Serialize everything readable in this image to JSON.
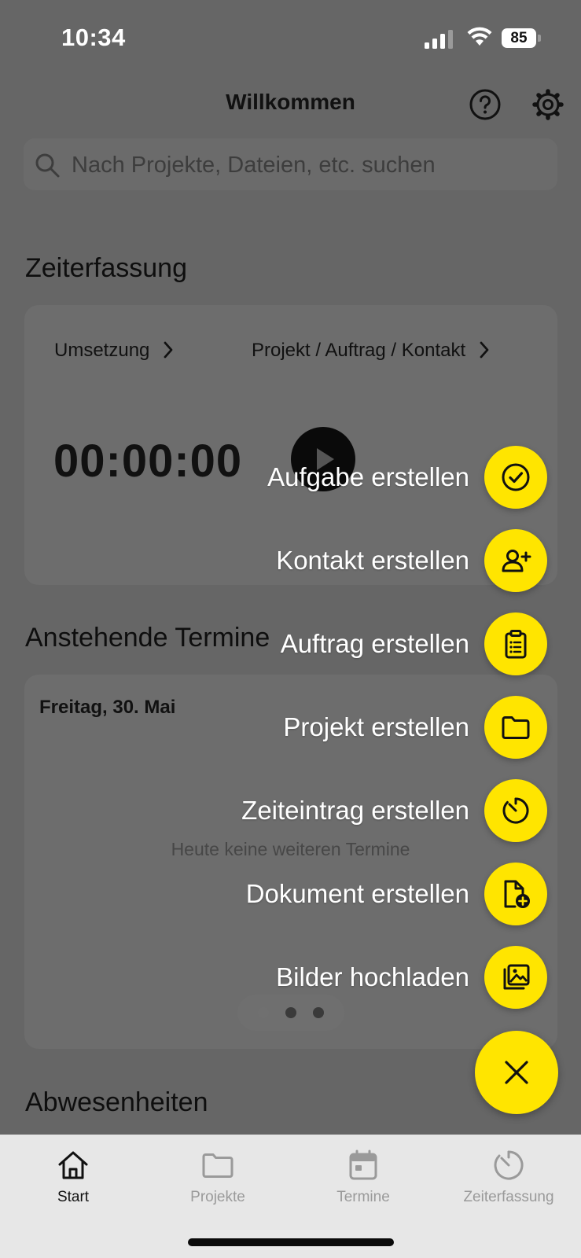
{
  "status_bar": {
    "time": "10:34",
    "battery": "85"
  },
  "header": {
    "title": "Willkommen"
  },
  "search": {
    "placeholder": "Nach Projekte, Dateien, etc. suchen"
  },
  "time_tracking": {
    "title": "Zeiterfassung",
    "activity": "Umsetzung",
    "target": "Projekt / Auftrag / Kontakt",
    "timer": "00:00:00"
  },
  "appointments": {
    "title": "Anstehende Termine",
    "date": "Freitag, 30. Mai",
    "empty": "Heute keine weiteren Termine"
  },
  "absences": {
    "title": "Abwesenheiten"
  },
  "fab_menu": {
    "items": [
      {
        "label": "Aufgabe erstellen",
        "icon": "check-circle-icon"
      },
      {
        "label": "Kontakt erstellen",
        "icon": "user-plus-icon"
      },
      {
        "label": "Auftrag erstellen",
        "icon": "clipboard-list-icon"
      },
      {
        "label": "Projekt erstellen",
        "icon": "folder-icon"
      },
      {
        "label": "Zeiteintrag erstellen",
        "icon": "timer-icon"
      },
      {
        "label": "Dokument erstellen",
        "icon": "document-plus-icon"
      },
      {
        "label": "Bilder hochladen",
        "icon": "images-icon"
      }
    ],
    "close_icon": "close-icon",
    "accent": "#FFE500"
  },
  "tabbar": {
    "tabs": [
      {
        "label": "Start",
        "icon": "home-icon",
        "active": true
      },
      {
        "label": "Projekte",
        "icon": "folder-icon",
        "active": false
      },
      {
        "label": "Termine",
        "icon": "calendar-icon",
        "active": false
      },
      {
        "label": "Zeiterfassung",
        "icon": "timer-icon",
        "active": false
      }
    ]
  }
}
